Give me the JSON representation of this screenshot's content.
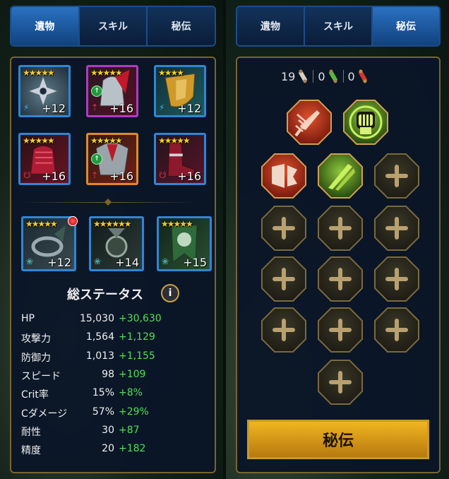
{
  "left": {
    "tabs": [
      {
        "label": "遺物",
        "active": true
      },
      {
        "label": "スキル",
        "active": false
      },
      {
        "label": "秘伝",
        "active": false
      }
    ],
    "gear": [
      {
        "name": "weapon",
        "level": "+12",
        "stars": "★★★★★",
        "rarity": "epic",
        "set": "speed",
        "set_icon": "⚡",
        "set_color": "#3ab4f0",
        "art": "shuriken"
      },
      {
        "name": "helmet",
        "level": "+16",
        "stars": "★★★★★",
        "rarity": "legendary",
        "set": "upgrade",
        "set_icon": "⇡",
        "set_color": "#c3324a",
        "art": "helmet"
      },
      {
        "name": "shield",
        "level": "+12",
        "stars": "★★★★",
        "rarity": "epic",
        "set": "speed",
        "set_icon": "⚡",
        "set_color": "#3ab4f0",
        "art": "shield"
      },
      {
        "name": "gauntlets",
        "level": "+16",
        "stars": "★★★★★",
        "rarity": "epic",
        "set": "lifesteal",
        "set_icon": "☋",
        "set_color": "#c3324a",
        "art": "gauntlets"
      },
      {
        "name": "chestplate",
        "level": "+16",
        "stars": "★★★★★",
        "rarity": "mythic",
        "set": "upgrade",
        "set_icon": "⇡",
        "set_color": "#c3324a",
        "art": "chest"
      },
      {
        "name": "boots",
        "level": "+16",
        "stars": "★★★★★",
        "rarity": "epic",
        "set": "lifesteal",
        "set_icon": "☋",
        "set_color": "#c3324a",
        "art": "boots"
      }
    ],
    "accessories": [
      {
        "name": "ring",
        "level": "+12",
        "stars": "★★★★★",
        "set_icon": "❀",
        "art": "ring"
      },
      {
        "name": "amulet",
        "level": "+14",
        "stars": "★★★★★★",
        "set_icon": "❀",
        "art": "amulet"
      },
      {
        "name": "banner",
        "level": "+15",
        "stars": "★★★★★",
        "set_icon": "❀",
        "art": "banner"
      }
    ],
    "stats_title": "総ステータス",
    "info_label": "i",
    "stats": [
      {
        "label": "HP",
        "base": "15,030",
        "bonus": "+30,630"
      },
      {
        "label": "攻撃力",
        "base": "1,564",
        "bonus": "+1,129"
      },
      {
        "label": "防御力",
        "base": "1,013",
        "bonus": "+1,155"
      },
      {
        "label": "スピード",
        "base": "98",
        "bonus": "+109"
      },
      {
        "label": "Crit率",
        "base": "15%",
        "bonus": "+8%"
      },
      {
        "label": "Cダメージ",
        "base": "57%",
        "bonus": "+29%"
      },
      {
        "label": "耐性",
        "base": "30",
        "bonus": "+87"
      },
      {
        "label": "精度",
        "base": "20",
        "bonus": "+182"
      }
    ]
  },
  "right": {
    "tabs": [
      {
        "label": "遺物",
        "active": false
      },
      {
        "label": "スキル",
        "active": false
      },
      {
        "label": "秘伝",
        "active": true
      }
    ],
    "counters": [
      {
        "value": "19",
        "icon": "white-scroll-icon",
        "color": "#d9d0c0"
      },
      {
        "value": "0",
        "icon": "green-scroll-icon",
        "color": "#5bb83a"
      },
      {
        "value": "0",
        "icon": "red-scroll-icon",
        "color": "#d03a2a"
      }
    ],
    "masteries": [
      {
        "name": "blade-mastery",
        "state": "offense",
        "icon": "blade-icon"
      },
      {
        "name": "fist-mastery",
        "state": "support",
        "icon": "fist-icon"
      },
      {
        "name": "shield-break-mastery",
        "state": "offense",
        "icon": "shield-break-icon"
      },
      {
        "name": "cross-blades-mastery",
        "state": "support",
        "icon": "cross-blades-icon"
      },
      {
        "name": "empty-mastery-1",
        "state": "empty",
        "icon": "plus-icon"
      },
      {
        "name": "empty-mastery-2",
        "state": "empty",
        "icon": "plus-icon"
      },
      {
        "name": "empty-mastery-3",
        "state": "empty",
        "icon": "plus-icon"
      },
      {
        "name": "empty-mastery-4",
        "state": "empty",
        "icon": "plus-icon"
      },
      {
        "name": "empty-mastery-5",
        "state": "empty",
        "icon": "plus-icon"
      },
      {
        "name": "empty-mastery-6",
        "state": "empty",
        "icon": "plus-icon"
      },
      {
        "name": "empty-mastery-7",
        "state": "empty",
        "icon": "plus-icon"
      },
      {
        "name": "empty-mastery-8",
        "state": "empty",
        "icon": "plus-icon"
      },
      {
        "name": "empty-mastery-9",
        "state": "empty",
        "icon": "plus-icon"
      },
      {
        "name": "empty-mastery-10",
        "state": "empty",
        "icon": "plus-icon"
      },
      {
        "name": "empty-mastery-11",
        "state": "empty",
        "icon": "plus-icon"
      },
      {
        "name": "empty-mastery-12",
        "state": "empty",
        "icon": "plus-icon"
      }
    ],
    "button_label": "秘伝"
  },
  "colors": {
    "tab_active": "#2a71c2",
    "frame_gold": "#7a6530",
    "bonus_green": "#4fe053",
    "button_gold": "#f1b521",
    "star": "#f7cc2a"
  }
}
